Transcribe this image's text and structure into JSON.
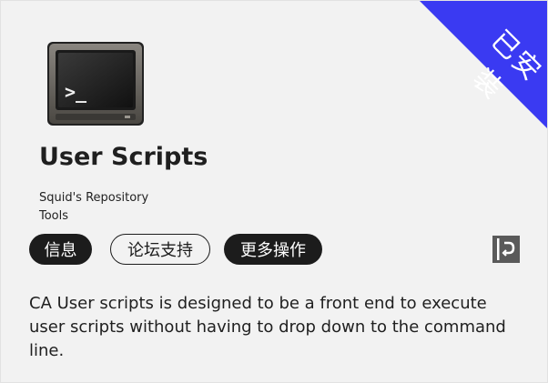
{
  "ribbon": {
    "label": "已安装",
    "color": "#3a3af2"
  },
  "app": {
    "icon": "terminal-monitor-icon",
    "name": "User Scripts",
    "author": "Squid's Repository",
    "category": "Tools",
    "description": "CA User scripts is designed to be a front end to execute user scripts without having to drop down to the command line."
  },
  "actions": {
    "info_label": "信息",
    "forum_label": "论坛支持",
    "more_label": "更多操作",
    "support_icon": "support-link-icon"
  },
  "colors": {
    "accent": "#3a3af2",
    "button_dark": "#1c1c1c",
    "background": "#f2f2f2"
  }
}
